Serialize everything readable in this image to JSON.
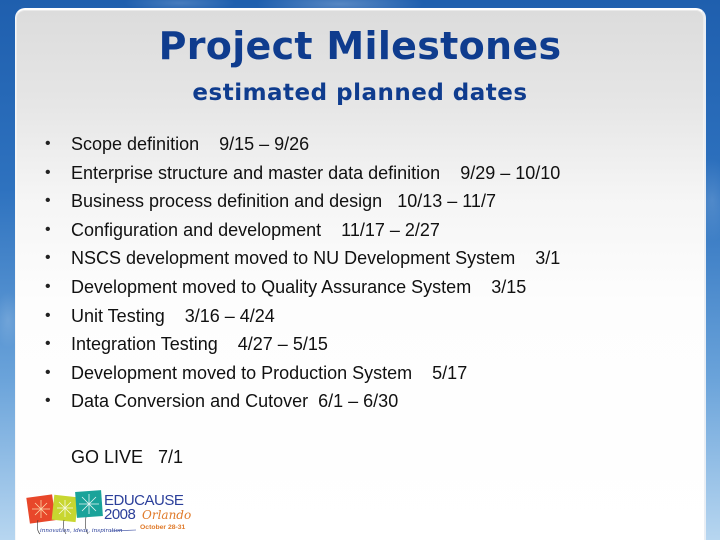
{
  "slide": {
    "title": "Project Milestones",
    "subtitle": "estimated planned dates",
    "milestones": [
      {
        "text": "Scope definition    9/15 – 9/26"
      },
      {
        "text": "Enterprise structure and master data definition    9/29 – 10/10"
      },
      {
        "text": "Business process definition and design   10/13 – 11/7"
      },
      {
        "text": "Configuration and development    11/17 – 2/27"
      },
      {
        "text": "NSCS development moved to NU Development System    3/1"
      },
      {
        "text": "Development moved to Quality Assurance System    3/15"
      },
      {
        "text": "Unit Testing    3/16 – 4/24"
      },
      {
        "text": "Integration Testing    4/27 – 5/15"
      },
      {
        "text": "Development moved to Production System    5/17"
      },
      {
        "text": "Data Conversion and Cutover  6/1 – 6/30"
      }
    ],
    "bullet_glyph": "•",
    "go_live": "GO LIVE   7/1"
  },
  "logo": {
    "name": "EDUCAUSE",
    "year": "2008",
    "city": "Orlando",
    "dates": "October 28-31",
    "tagline": "innovation, ideas, inspiration",
    "colors": {
      "kite_red": "#e8472a",
      "kite_yellow": "#c8d630",
      "kite_teal": "#1aa39a",
      "wordmark": "#2b3f9a",
      "accent": "#e07a2a"
    }
  },
  "theme": {
    "title_color": "#0f3c8e",
    "text_color": "#111111",
    "frame_blue": "#1f5fae"
  }
}
